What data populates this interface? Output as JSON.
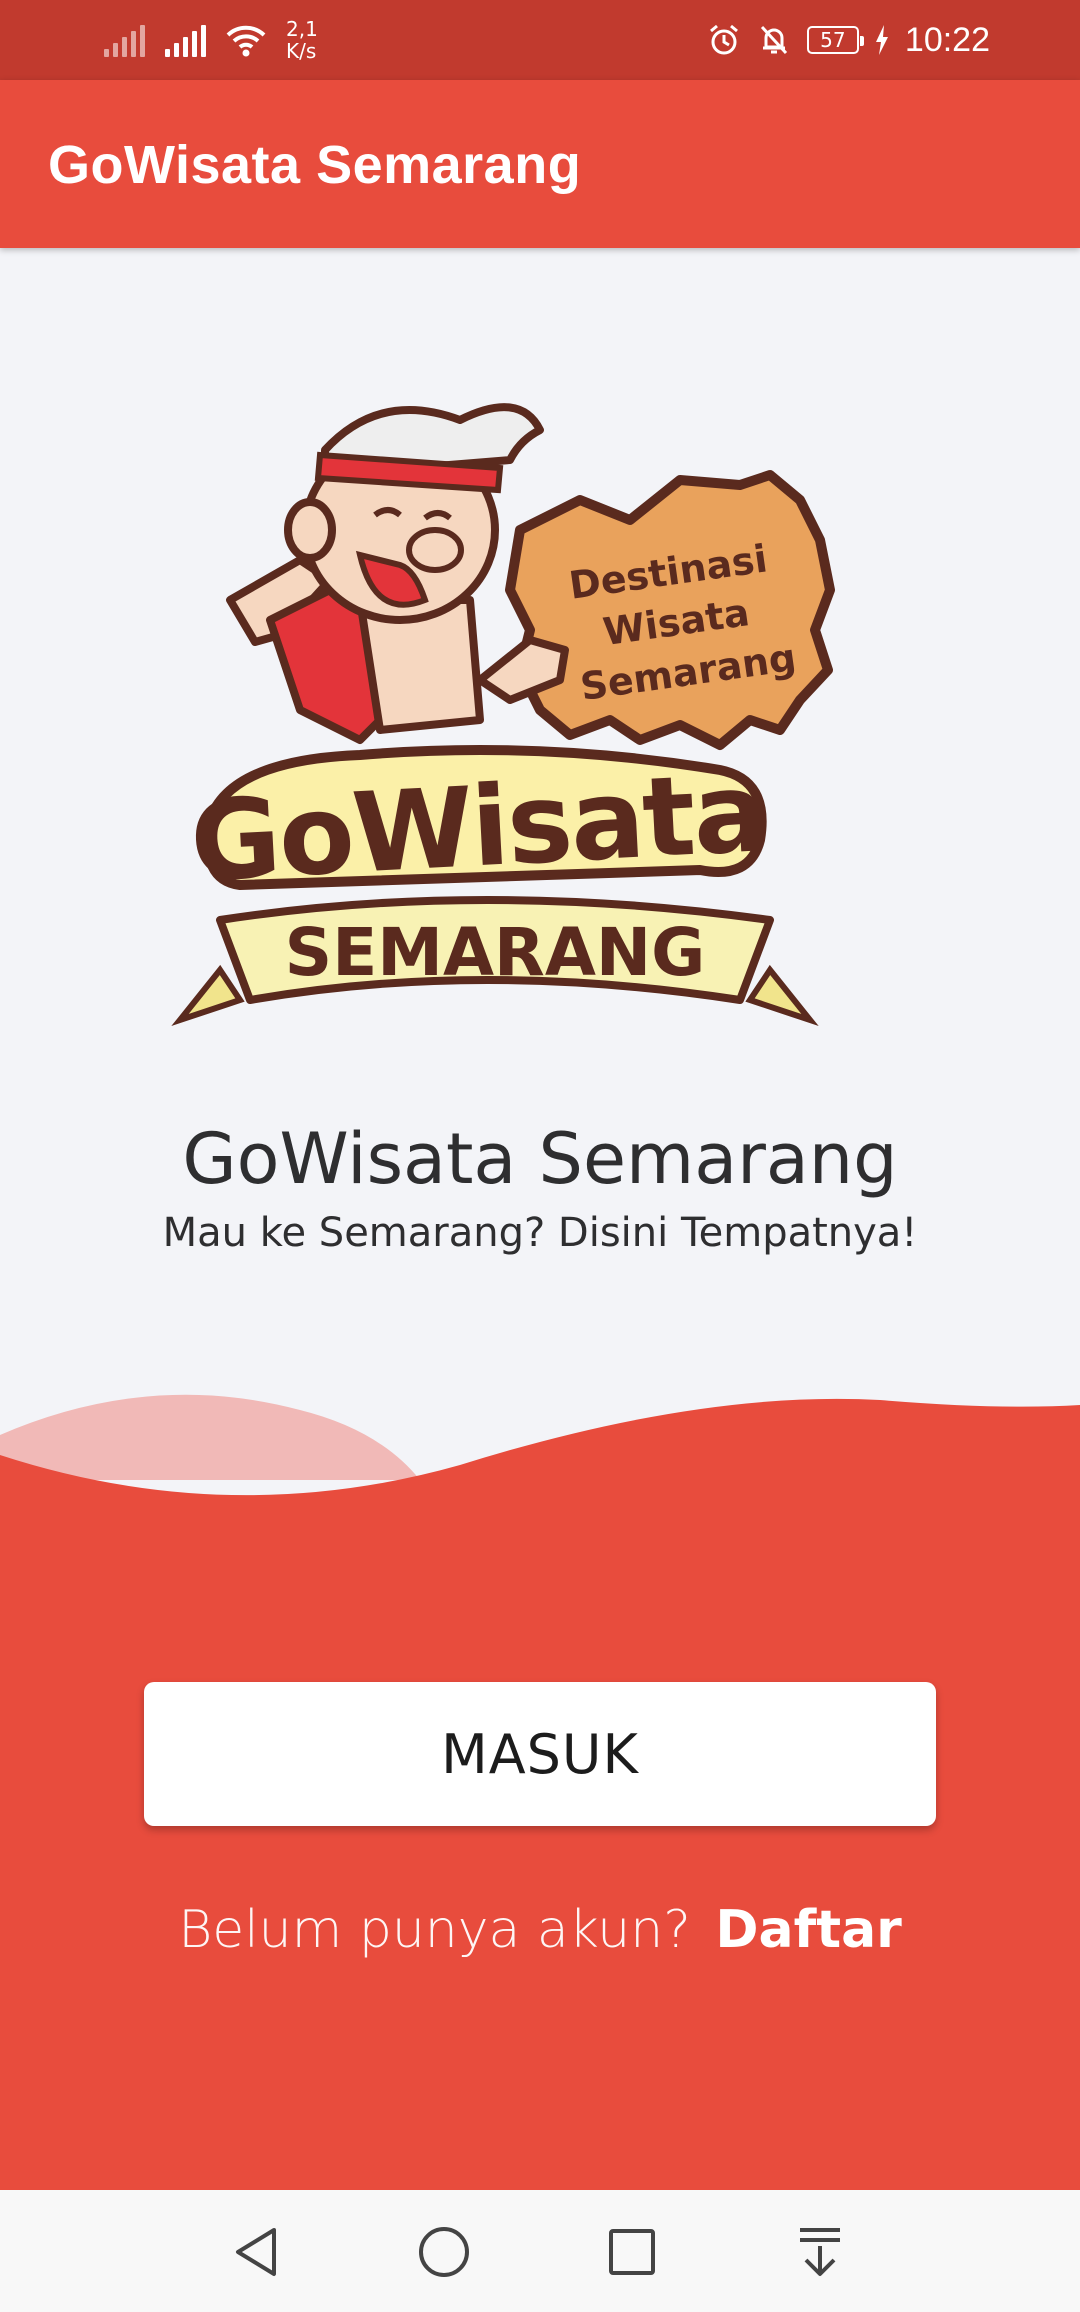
{
  "status_bar": {
    "net_speed_value": "2,1",
    "net_speed_unit": "K/s",
    "battery": "57",
    "time": "10:22"
  },
  "app_bar": {
    "title": "GoWisata Semarang"
  },
  "logo": {
    "badge_line1": "Destinasi",
    "badge_line2": "Wisata",
    "badge_line3": "Semarang",
    "word_main": "GoWisata",
    "word_ribbon": "SEMARANG"
  },
  "hero": {
    "title": "GoWisata Semarang",
    "subtitle": "Mau ke Semarang? Disini Tempatnya!"
  },
  "actions": {
    "login_label": "MASUK",
    "register_question": "Belum punya akun?",
    "register_link": "Daftar"
  },
  "colors": {
    "primary": "#e84c3d",
    "status_bar": "#c13a2e",
    "background": "#f3f4f8",
    "text_dark": "#2e2e30"
  },
  "nav_bar": {
    "icons": [
      "back-icon",
      "home-icon",
      "recents-icon",
      "notification-drawer-icon"
    ]
  }
}
